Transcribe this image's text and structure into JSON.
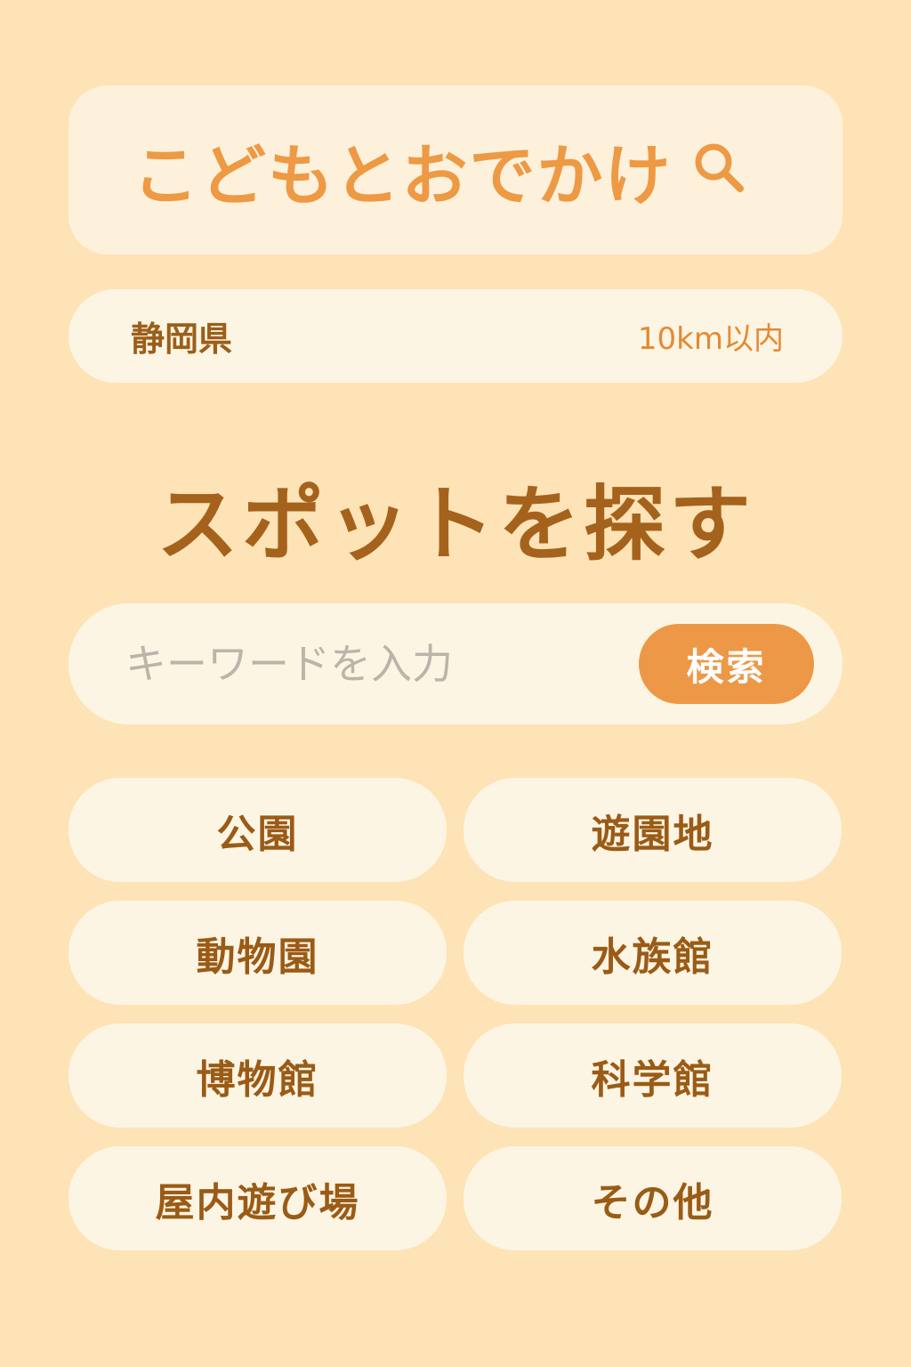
{
  "header": {
    "title": "こどもとおでかけ",
    "icon": "search-icon"
  },
  "location": {
    "region": "静岡県",
    "distance": "10km以内"
  },
  "section": {
    "title": "スポットを探す"
  },
  "search": {
    "placeholder": "キーワードを入力",
    "value": "",
    "button_label": "検索"
  },
  "categories": [
    {
      "label": "公園"
    },
    {
      "label": "遊園地"
    },
    {
      "label": "動物園"
    },
    {
      "label": "水族館"
    },
    {
      "label": "博物館"
    },
    {
      "label": "科学館"
    },
    {
      "label": "屋内遊び場"
    },
    {
      "label": "その他"
    }
  ],
  "colors": {
    "background": "#fde3b6",
    "card": "#fdf5e4",
    "accent": "#ed9846",
    "text_brown": "#9a5b16"
  }
}
